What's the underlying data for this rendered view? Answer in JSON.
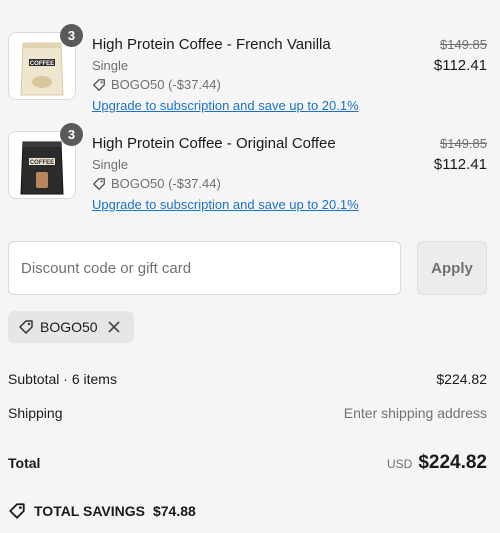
{
  "items": [
    {
      "quantity": "3",
      "name": "High Protein Coffee - French Vanilla",
      "variant": "Single",
      "discount": "BOGO50 (-$37.44)",
      "upgrade_link": "Upgrade to subscription and save up to 20.1%",
      "original_price": "$149.85",
      "price": "$112.41",
      "bag_color": "#efe6cf",
      "bag_label": "COFFEE"
    },
    {
      "quantity": "3",
      "name": "High Protein Coffee - Original Coffee",
      "variant": "Single",
      "discount": "BOGO50 (-$37.44)",
      "upgrade_link": "Upgrade to subscription and save up to 20.1%",
      "original_price": "$149.85",
      "price": "$112.41",
      "bag_color": "#2b2b2b",
      "bag_label": "COFFEE"
    }
  ],
  "discount_field": {
    "placeholder": "Discount code or gift card",
    "value": ""
  },
  "apply_button": "Apply",
  "applied_code": "BOGO50",
  "summary": {
    "subtotal_label": "Subtotal · 6 items",
    "subtotal_value": "$224.82",
    "shipping_label": "Shipping",
    "shipping_value": "Enter shipping address",
    "total_label": "Total",
    "currency": "USD",
    "total_value": "$224.82"
  },
  "savings": {
    "label": "TOTAL SAVINGS",
    "amount": "$74.88"
  },
  "icons": [
    "tag-icon",
    "close-icon",
    "product-bag-icon"
  ]
}
